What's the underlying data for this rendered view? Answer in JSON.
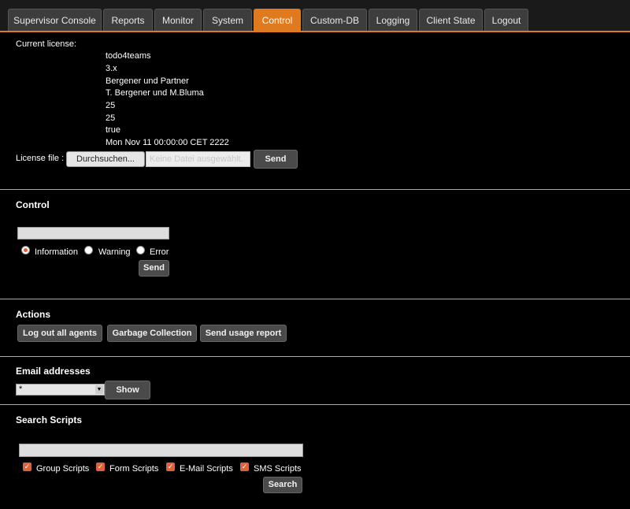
{
  "tabs": [
    {
      "label": "Supervisor Console"
    },
    {
      "label": "Reports"
    },
    {
      "label": "Monitor"
    },
    {
      "label": "System"
    },
    {
      "label": "Control",
      "active": true
    },
    {
      "label": "Custom-DB"
    },
    {
      "label": "Logging"
    },
    {
      "label": "Client State"
    },
    {
      "label": "Logout"
    }
  ],
  "license": {
    "title": "Current license:",
    "lines": [
      "todo4teams",
      "3.x",
      "Bergener und Partner",
      "T. Bergener und M.Bluma",
      "25",
      "25",
      "true",
      "Mon Nov 11 00:00:00 CET 2222"
    ],
    "file_label": "License file :",
    "browse_label": "Durchsuchen...",
    "no_file_text": "Keine Datei ausgewählt.",
    "send_label": "Send"
  },
  "control": {
    "heading": "Control",
    "message_value": "",
    "options": [
      "Information",
      "Warning",
      "Error"
    ],
    "selected": "Information",
    "send_label": "Send"
  },
  "actions": {
    "heading": "Actions",
    "buttons": [
      "Log out all agents",
      "Garbage Collection",
      "Send usage report"
    ]
  },
  "email": {
    "heading": "Email addresses",
    "selected": "*",
    "show_label": "Show"
  },
  "search": {
    "heading": "Search Scripts",
    "query": "",
    "filters": [
      "Group Scripts",
      "Form Scripts",
      "E-Mail Scripts",
      "SMS Scripts"
    ],
    "search_label": "Search"
  },
  "colors": {
    "accent": "#e07a1e",
    "checkbox": "#e0603a"
  }
}
